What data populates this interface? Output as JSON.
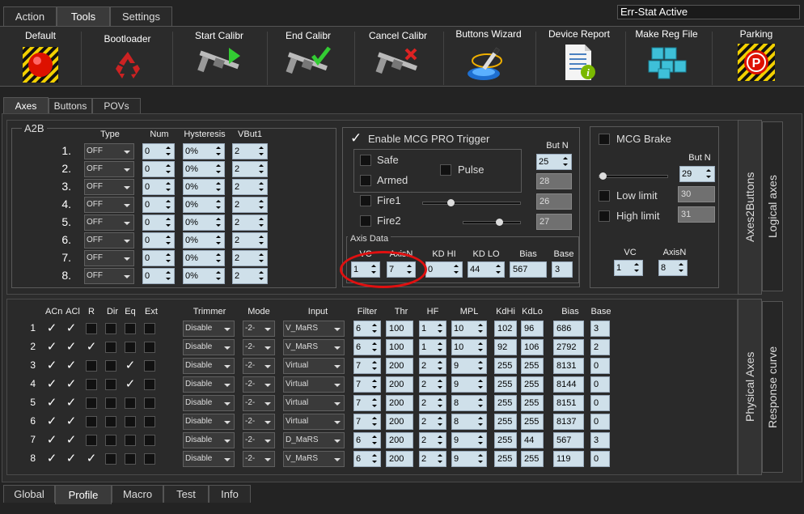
{
  "top_tabs": [
    "Action",
    "Tools",
    "Settings"
  ],
  "status_text": "Err-Stat Active",
  "toolbar": [
    {
      "label": "Default",
      "icon": "red-button-icon"
    },
    {
      "label": "Bootloader",
      "icon": "recycle-icon"
    },
    {
      "label": "Start Calibr",
      "icon": "caliper-play-icon"
    },
    {
      "label": "End Calibr",
      "icon": "caliper-check-icon"
    },
    {
      "label": "Cancel Calibr",
      "icon": "caliper-cross-icon"
    },
    {
      "label": "Buttons Wizard",
      "icon": "wizard-icon"
    },
    {
      "label": "Device Report",
      "icon": "report-icon"
    },
    {
      "label": "Make Reg File",
      "icon": "cubes-icon"
    },
    {
      "label": "Parking",
      "icon": "parking-icon"
    }
  ],
  "sub_tabs": [
    "Axes",
    "Buttons",
    "POVs"
  ],
  "a2b": {
    "title": "A2B",
    "headers": [
      "Type",
      "Num",
      "Hysteresis",
      "VBut1"
    ],
    "rows": [
      {
        "n": "1.",
        "type": "OFF",
        "num": "0",
        "hyst": "0%",
        "vbut": "2"
      },
      {
        "n": "2.",
        "type": "OFF",
        "num": "0",
        "hyst": "0%",
        "vbut": "2"
      },
      {
        "n": "3.",
        "type": "OFF",
        "num": "0",
        "hyst": "0%",
        "vbut": "2"
      },
      {
        "n": "4.",
        "type": "OFF",
        "num": "0",
        "hyst": "0%",
        "vbut": "2"
      },
      {
        "n": "5.",
        "type": "OFF",
        "num": "0",
        "hyst": "0%",
        "vbut": "2"
      },
      {
        "n": "6.",
        "type": "OFF",
        "num": "0",
        "hyst": "0%",
        "vbut": "2"
      },
      {
        "n": "7.",
        "type": "OFF",
        "num": "0",
        "hyst": "0%",
        "vbut": "2"
      },
      {
        "n": "8.",
        "type": "OFF",
        "num": "0",
        "hyst": "0%",
        "vbut": "2"
      }
    ]
  },
  "mcg": {
    "enable_label": "Enable MCG PRO Trigger",
    "safe": "Safe",
    "armed": "Armed",
    "pulse": "Pulse",
    "fire1": "Fire1",
    "fire2": "Fire2",
    "butn_label": "But N",
    "butn": "25",
    "v2": "28",
    "v3": "26",
    "v4": "27",
    "axis_data_label": "Axis Data",
    "ad_headers": [
      "VC",
      "AxisN",
      "KD HI",
      "KD LO",
      "Bias",
      "Base"
    ],
    "ad_values": [
      "1",
      "7",
      "0",
      "44",
      "567",
      "3"
    ]
  },
  "brake": {
    "label": "MCG Brake",
    "butn_label": "But N",
    "butn": "29",
    "low": "Low limit",
    "low_val": "30",
    "high": "High limit",
    "high_val": "31",
    "vc_label": "VC",
    "axisn_label": "AxisN",
    "vc": "1",
    "axisn": "8"
  },
  "vtabs": {
    "a2b": "Axes2Buttons",
    "logical": "Logical axes",
    "physical": "Physical Axes",
    "response": "Response curve"
  },
  "phys": {
    "headers": [
      "ACn",
      "ACl",
      "R",
      "Dir",
      "Eq",
      "Ext",
      "Trimmer",
      "Mode",
      "Input",
      "Filter",
      "Thr",
      "HF",
      "MPL",
      "KdHi",
      "KdLo",
      "Bias",
      "Base"
    ],
    "rows": [
      {
        "n": "1",
        "c": [
          1,
          1,
          0,
          0,
          0,
          0
        ],
        "trim": "Disable",
        "mode": "-2-",
        "input": "V_MaRS",
        "filter": "6",
        "thr": "100",
        "hf": "1",
        "mpl": "10",
        "kdhi": "102",
        "kdlo": "96",
        "bias": "686",
        "base": "3"
      },
      {
        "n": "2",
        "c": [
          1,
          1,
          1,
          0,
          0,
          0
        ],
        "trim": "Disable",
        "mode": "-2-",
        "input": "V_MaRS",
        "filter": "6",
        "thr": "100",
        "hf": "1",
        "mpl": "10",
        "kdhi": "92",
        "kdlo": "106",
        "bias": "2792",
        "base": "2"
      },
      {
        "n": "3",
        "c": [
          1,
          1,
          0,
          0,
          1,
          0
        ],
        "trim": "Disable",
        "mode": "-2-",
        "input": "Virtual",
        "filter": "7",
        "thr": "200",
        "hf": "2",
        "mpl": "9",
        "kdhi": "255",
        "kdlo": "255",
        "bias": "8131",
        "base": "0"
      },
      {
        "n": "4",
        "c": [
          1,
          1,
          0,
          0,
          1,
          0
        ],
        "trim": "Disable",
        "mode": "-2-",
        "input": "Virtual",
        "filter": "7",
        "thr": "200",
        "hf": "2",
        "mpl": "9",
        "kdhi": "255",
        "kdlo": "255",
        "bias": "8144",
        "base": "0"
      },
      {
        "n": "5",
        "c": [
          1,
          1,
          0,
          0,
          0,
          0
        ],
        "trim": "Disable",
        "mode": "-2-",
        "input": "Virtual",
        "filter": "7",
        "thr": "200",
        "hf": "2",
        "mpl": "8",
        "kdhi": "255",
        "kdlo": "255",
        "bias": "8151",
        "base": "0"
      },
      {
        "n": "6",
        "c": [
          1,
          1,
          0,
          0,
          0,
          0
        ],
        "trim": "Disable",
        "mode": "-2-",
        "input": "Virtual",
        "filter": "7",
        "thr": "200",
        "hf": "2",
        "mpl": "8",
        "kdhi": "255",
        "kdlo": "255",
        "bias": "8137",
        "base": "0"
      },
      {
        "n": "7",
        "c": [
          1,
          1,
          0,
          0,
          0,
          0
        ],
        "trim": "Disable",
        "mode": "-2-",
        "input": "D_MaRS",
        "filter": "6",
        "thr": "200",
        "hf": "2",
        "mpl": "9",
        "kdhi": "255",
        "kdlo": "44",
        "bias": "567",
        "base": "3"
      },
      {
        "n": "8",
        "c": [
          1,
          1,
          1,
          0,
          0,
          0
        ],
        "trim": "Disable",
        "mode": "-2-",
        "input": "V_MaRS",
        "filter": "6",
        "thr": "200",
        "hf": "2",
        "mpl": "9",
        "kdhi": "255",
        "kdlo": "255",
        "bias": "119",
        "base": "0"
      }
    ]
  },
  "bottom_tabs": [
    "Global",
    "Profile",
    "Macro",
    "Test",
    "Info"
  ]
}
